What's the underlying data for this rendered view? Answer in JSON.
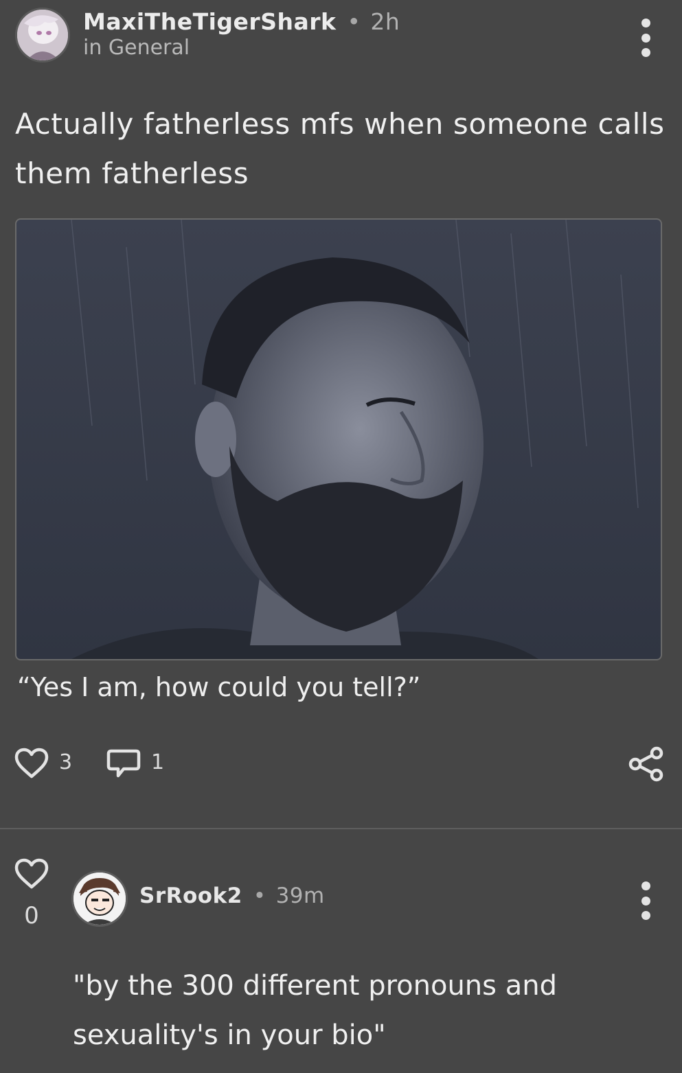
{
  "post": {
    "username": "MaxiTheTigerShark",
    "separator": "•",
    "time": "2h",
    "community": "in General",
    "title": "Actually fatherless mfs when someone calls them fatherless",
    "caption": "“Yes I am, how could you tell?”",
    "likes": "3",
    "comments": "1",
    "icons": [
      "avatar",
      "more-vert-icon",
      "heart-icon",
      "comment-bubble-icon",
      "share-icon"
    ]
  },
  "comment": {
    "likes": "0",
    "username": "SrRook2",
    "separator": "•",
    "time": "39m",
    "text": "\"by the 300 different pronouns and sexuality's in your bio\"",
    "icons": [
      "heart-icon",
      "avatar",
      "more-vert-icon"
    ]
  },
  "colors": {
    "background": "#464646",
    "text": "#f0f0f0",
    "muted": "#b2b2b2",
    "divider": "#5e5e5e"
  }
}
